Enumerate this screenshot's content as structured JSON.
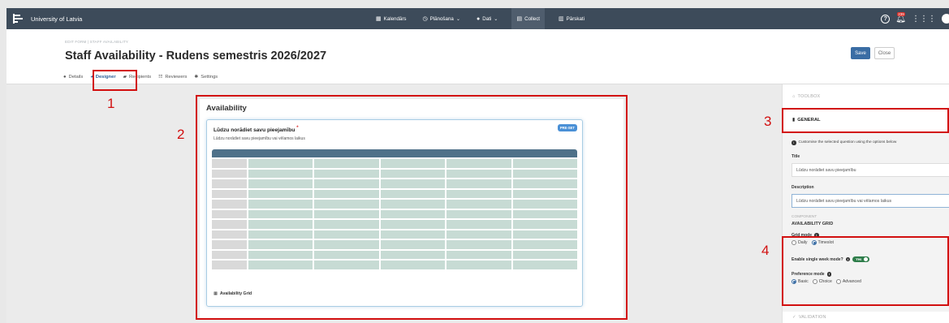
{
  "topbar": {
    "brand": "University of Latvia",
    "nav": [
      {
        "icon": "calendar-icon",
        "glyph": "▦",
        "label": "Kalendārs",
        "dropdown": false
      },
      {
        "icon": "clock-icon",
        "glyph": "◷",
        "label": "Plānošana",
        "dropdown": true
      },
      {
        "icon": "database-icon",
        "glyph": "●",
        "label": "Dati",
        "dropdown": true
      },
      {
        "icon": "form-icon",
        "glyph": "▤",
        "label": "Collect",
        "dropdown": false
      },
      {
        "icon": "chart-icon",
        "glyph": "▥",
        "label": "Pārskati",
        "dropdown": false
      }
    ],
    "notification_count": "239"
  },
  "header": {
    "breadcrumb": "EDIT FORM | STAFF AVAILABILITY",
    "title": "Staff Availability - Rudens semestris 2026/2027",
    "save_label": "Save",
    "close_label": "Close",
    "tabs": [
      {
        "label": "Details",
        "icon": "info-icon",
        "glyph": "●"
      },
      {
        "label": "Designer",
        "icon": "palette-icon",
        "glyph": "◕"
      },
      {
        "label": "Recipients",
        "icon": "users-icon",
        "glyph": "▰"
      },
      {
        "label": "Reviewers",
        "icon": "reviewers-icon",
        "glyph": "☷"
      },
      {
        "label": "Settings",
        "icon": "gear-icon",
        "glyph": "✱"
      }
    ]
  },
  "canvas": {
    "section_title": "Availability",
    "question": {
      "title": "Lūdzu norādiet savu pieejamību",
      "required_mark": "*",
      "description": "Lūdzu norādiet savu pieejamību vai vēlamos laikus",
      "badge": "PRE-SET",
      "footer_label": "Availability Grid",
      "grid_rows": 11,
      "grid_cols": 5
    }
  },
  "annotations": [
    "1",
    "2",
    "3",
    "4"
  ],
  "sidebar": {
    "toolbox_label": "TOOLBOX",
    "general_label": "GENERAL",
    "note": "Customise the selected question using the options below",
    "title_label": "Title",
    "title_value": "Lūdzu norādiet savu pieejamību",
    "description_label": "Description",
    "description_value": "Lūdzu norādiet savu pieejamību vai vēlamos laikus",
    "component_label": "COMPONENT",
    "component_value": "AVAILABILITY GRID",
    "grid_mode_label": "Grid mode",
    "grid_mode_options": [
      "Daily",
      "Timeslot"
    ],
    "grid_mode_selected": "Timeslot",
    "single_week_label": "Enable single week mode?",
    "single_week_value": "Yes",
    "preference_label": "Preference mode",
    "preference_options": [
      "Basic",
      "Choice",
      "Advanced"
    ],
    "preference_selected": "Basic",
    "validation_label": "VALIDATION"
  }
}
